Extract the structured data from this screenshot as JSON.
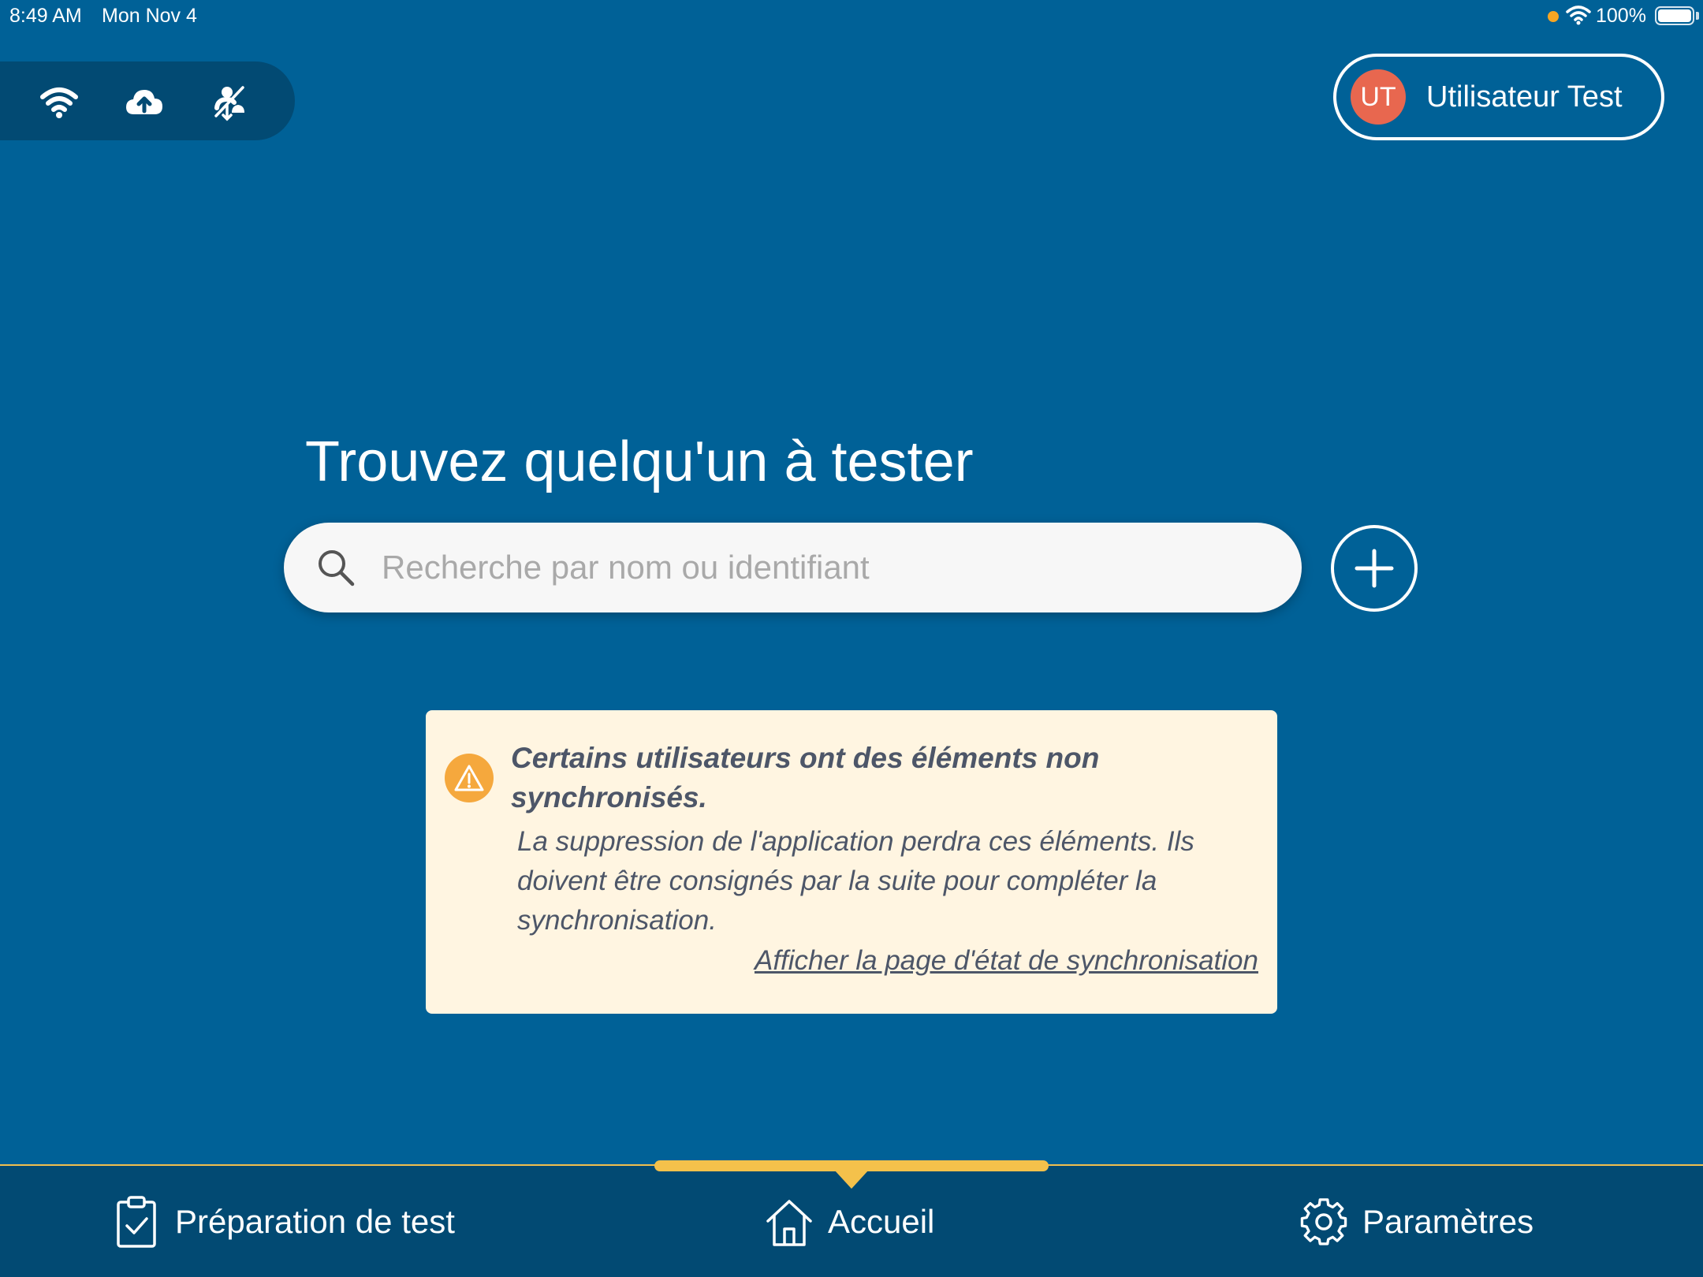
{
  "status_bar": {
    "time": "8:49 AM",
    "date": "Mon Nov 4",
    "battery": "100%",
    "icons": [
      "orange-dot",
      "wifi-icon",
      "battery-icon"
    ]
  },
  "connectivity": {
    "icons": [
      "wifi-icon",
      "cloud-upload-icon",
      "sync-disabled-icon"
    ]
  },
  "user": {
    "initials": "UT",
    "name": "Utilisateur Test",
    "avatar_color": "#e8674f"
  },
  "main": {
    "title": "Trouvez quelqu'un à tester",
    "search_placeholder": "Recherche par nom ou identifiant",
    "search_value": ""
  },
  "warning": {
    "title": "Certains utilisateurs ont des éléments non synchronisés.",
    "body": "La suppression de l'application perdra ces éléments. Ils doivent être consignés par la suite pour compléter la synchronisation.",
    "link": "Afficher la page d'état de synchronisation"
  },
  "tabs": [
    {
      "label": "Préparation de test",
      "icon": "clipboard-check-icon",
      "active": false
    },
    {
      "label": "Accueil",
      "icon": "home-icon",
      "active": true
    },
    {
      "label": "Paramètres",
      "icon": "gear-icon",
      "active": false
    }
  ],
  "colors": {
    "background": "#006197",
    "dark_bar": "#024a73",
    "accent": "#f4c14b",
    "warning_bg": "#fff5e1",
    "warning_icon": "#f5a83d"
  }
}
